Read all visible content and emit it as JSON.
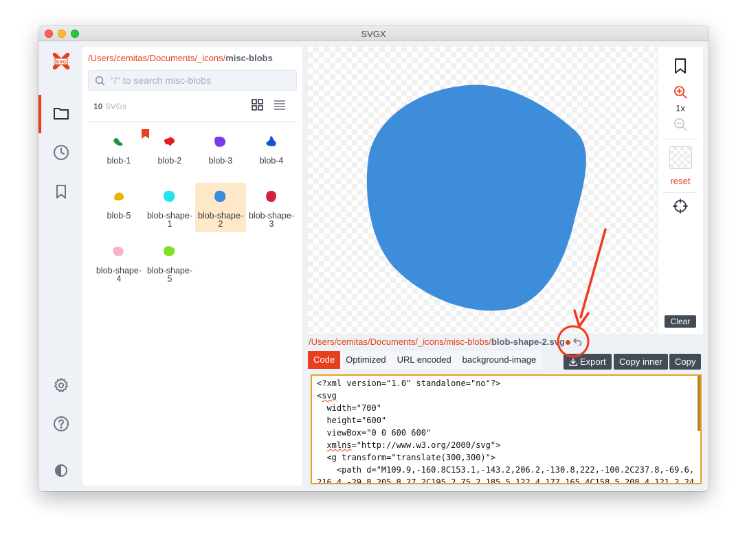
{
  "window": {
    "title": "SVGX"
  },
  "rail": {
    "items": [
      {
        "name": "logo",
        "icon": "svgx-logo-icon",
        "label": "SVG"
      },
      {
        "name": "files",
        "icon": "folder-icon",
        "active": true
      },
      {
        "name": "recent",
        "icon": "clock-icon"
      },
      {
        "name": "bookmarks",
        "icon": "bookmark-icon"
      },
      {
        "name": "settings",
        "icon": "gear-icon"
      },
      {
        "name": "help",
        "icon": "help-icon"
      },
      {
        "name": "theme",
        "icon": "contrast-icon"
      }
    ]
  },
  "files": {
    "breadcrumb": [
      "/",
      "Users",
      "/",
      "cemitas",
      "/",
      "Documents",
      "/",
      "_icons",
      "/"
    ],
    "breadcrumb_current": "misc-blobs",
    "search_placeholder": "\"/\" to search misc-blobs",
    "count_value": "10",
    "count_unit": "SVGs",
    "items": [
      {
        "label": "blob-1",
        "color": "#1f8f3a"
      },
      {
        "label": "blob-2",
        "color": "#e21b1b",
        "bookmarked": true
      },
      {
        "label": "blob-3",
        "color": "#7c3aed"
      },
      {
        "label": "blob-4",
        "color": "#1d4ed8"
      },
      {
        "label": "blob-5",
        "color": "#eab308"
      },
      {
        "label": "blob-shape-1",
        "color": "#22e6ee"
      },
      {
        "label": "blob-shape-2",
        "color": "#3b8ddc",
        "selected": true
      },
      {
        "label": "blob-shape-3",
        "color": "#d2223f"
      },
      {
        "label": "blob-shape-4",
        "color": "#f7b2c4"
      },
      {
        "label": "blob-shape-5",
        "color": "#7ee021"
      }
    ]
  },
  "preview": {
    "fill_color": "#3d8ddb",
    "zoom": "1x",
    "reset_label": "reset",
    "clear_label": "Clear"
  },
  "filepath": {
    "segments": [
      "/",
      "Users",
      "/",
      "cemitas",
      "/",
      "Documents",
      "/",
      "_icons",
      "/",
      "misc-blobs",
      "/"
    ],
    "filename": "blob-shape-2.svg"
  },
  "tabs": [
    "Code",
    "Optimized",
    "URL encoded",
    "background-image"
  ],
  "actions": {
    "export": "Export",
    "copy_inner": "Copy inner",
    "copy": "Copy"
  },
  "code": {
    "lines": [
      "<?xml version=\"1.0\" standalone=\"no\"?>",
      "<svg",
      "  width=\"700\"",
      "  height=\"600\"",
      "  viewBox=\"0 0 600 600\"",
      "  xmlns=\"http://www.w3.org/2000/svg\">",
      "  <g transform=\"translate(300,300)\">",
      "    <path d=\"M109.9,-160.8C153.1,-143.2,206.2,-130.8,222,-100.2C237.8,-69.6,",
      "216.4,-29.8,205.8,27.2C195.2,75.2,185.5,122.4,177,165.4C158.5,208.4,121.2,24"
    ]
  },
  "accent": "#e8401c",
  "annotation_color": "#ef3a1d"
}
